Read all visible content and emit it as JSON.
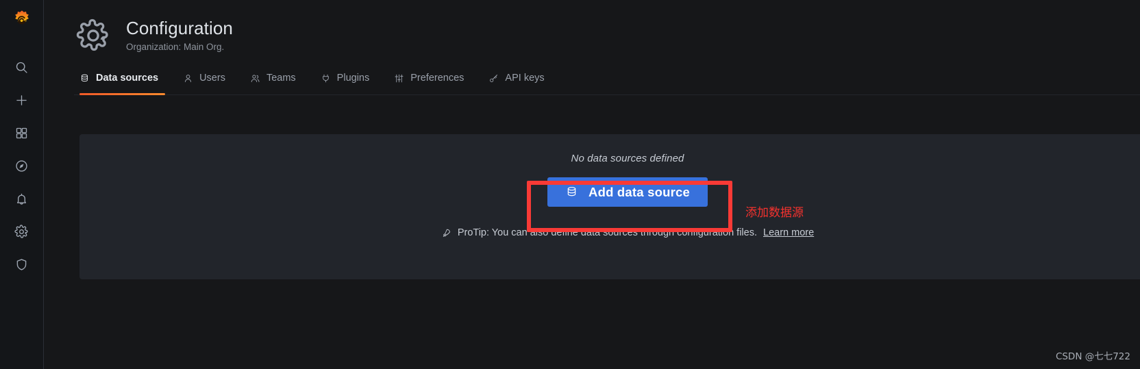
{
  "sidebar": {
    "logo": "grafana-logo",
    "items": [
      {
        "name": "search",
        "icon": "search-icon"
      },
      {
        "name": "create",
        "icon": "plus-icon"
      },
      {
        "name": "dashboards",
        "icon": "dashboards-grid-icon"
      },
      {
        "name": "explore",
        "icon": "compass-icon"
      },
      {
        "name": "alerting",
        "icon": "bell-icon"
      },
      {
        "name": "configuration",
        "icon": "gear-icon"
      },
      {
        "name": "server-admin",
        "icon": "shield-icon"
      }
    ]
  },
  "header": {
    "icon": "gear-icon",
    "title": "Configuration",
    "subtitle": "Organization: Main Org."
  },
  "tabs": [
    {
      "label": "Data sources",
      "icon": "database-icon",
      "active": true
    },
    {
      "label": "Users",
      "icon": "user-icon",
      "active": false
    },
    {
      "label": "Teams",
      "icon": "users-icon",
      "active": false
    },
    {
      "label": "Plugins",
      "icon": "plug-icon",
      "active": false
    },
    {
      "label": "Preferences",
      "icon": "sliders-icon",
      "active": false
    },
    {
      "label": "API keys",
      "icon": "key-icon",
      "active": false
    }
  ],
  "panel": {
    "empty_message": "No data sources defined",
    "add_button": {
      "label": "Add data source",
      "icon": "database-icon"
    },
    "protip": {
      "icon": "rocket-icon",
      "text": "ProTip: You can also define data sources through configuration files.",
      "link_label": "Learn more"
    }
  },
  "annotation": {
    "highlight_color": "#f93a36",
    "note_text": "添加数据源",
    "note_color": "#f5322e"
  },
  "watermark": {
    "text": "CSDN @七七722"
  },
  "colors": {
    "page_background": "#161719",
    "sidebar_background": "#141619",
    "panel_background": "#22252b",
    "primary_button": "#3871dc",
    "active_tab_underline": "#f05a28",
    "text_primary": "#dfe3e8",
    "text_muted": "#8e949d"
  }
}
